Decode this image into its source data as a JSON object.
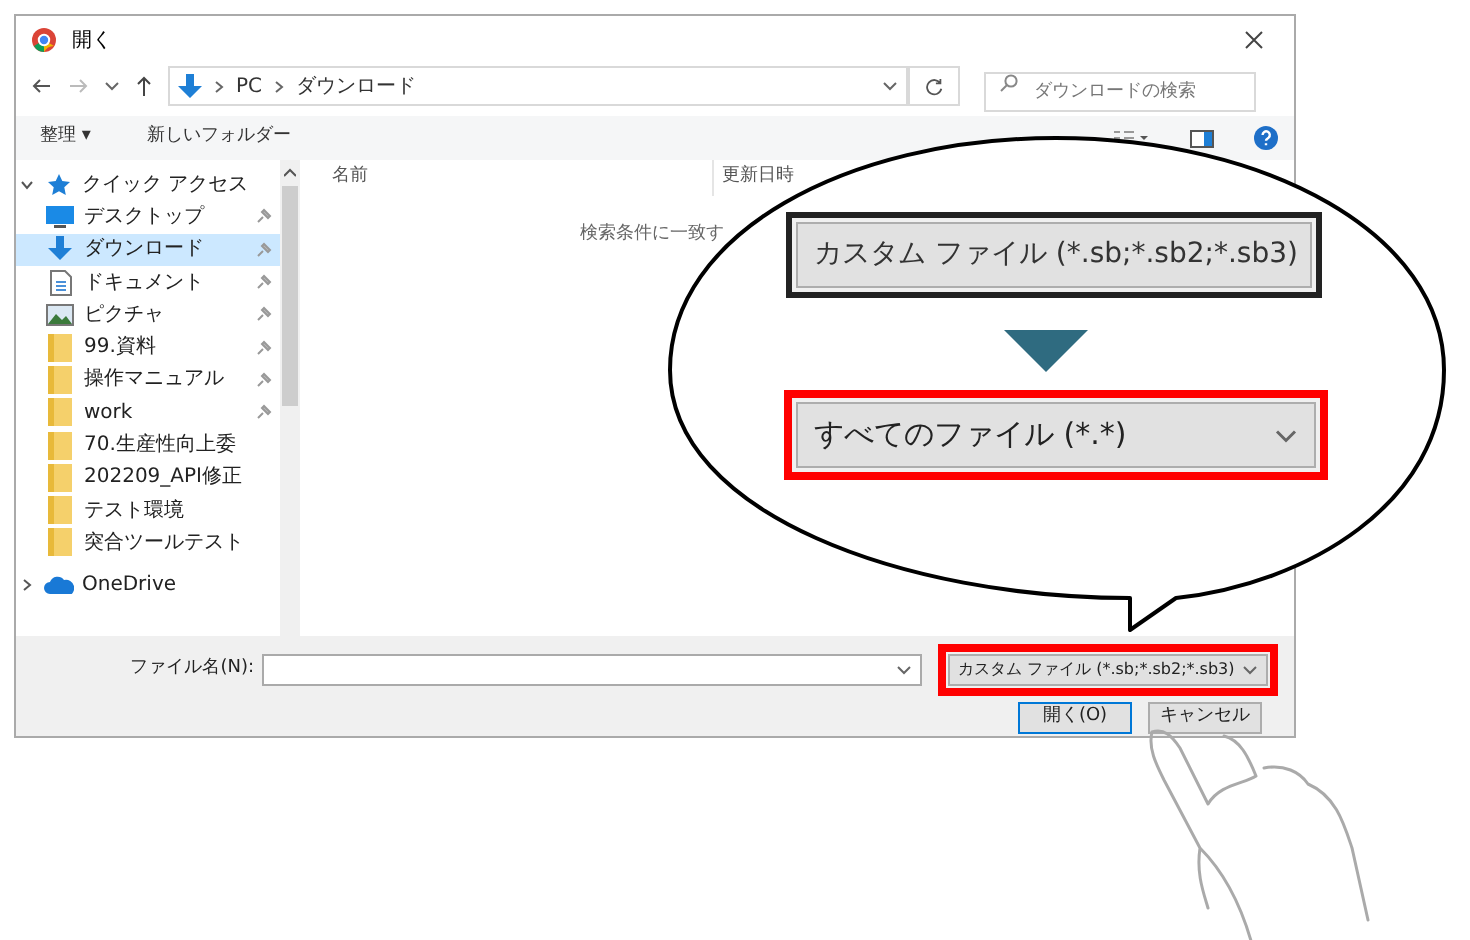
{
  "window": {
    "title": "開く"
  },
  "address": {
    "path": [
      "PC",
      "ダウンロード"
    ]
  },
  "search": {
    "placeholder": "ダウンロードの検索"
  },
  "toolbar": {
    "items": [
      "整理 ▾",
      "新しいフォルダー"
    ]
  },
  "sidebar": {
    "items": [
      {
        "label": "クイック アクセス",
        "kind": "quick",
        "expanded": true,
        "selected": false,
        "children": [
          {
            "label": "デスクトップ",
            "kind": "desktop",
            "pinned": true,
            "selected": false
          },
          {
            "label": "ダウンロード",
            "kind": "download",
            "pinned": true,
            "selected": true
          },
          {
            "label": "ドキュメント",
            "kind": "document",
            "pinned": true,
            "selected": false
          },
          {
            "label": "ピクチャ",
            "kind": "picture",
            "pinned": true,
            "selected": false
          },
          {
            "label": "99.資料",
            "kind": "folder",
            "pinned": true,
            "selected": false
          },
          {
            "label": "操作マニュアル",
            "kind": "folder",
            "pinned": true,
            "selected": false
          },
          {
            "label": "work",
            "kind": "folder",
            "pinned": true,
            "selected": false
          },
          {
            "label": "70.生産性向上委",
            "kind": "folder",
            "pinned": false,
            "selected": false
          },
          {
            "label": "202209_API修正",
            "kind": "folder",
            "pinned": false,
            "selected": false
          },
          {
            "label": "テスト環境",
            "kind": "folder",
            "pinned": false,
            "selected": false
          },
          {
            "label": "突合ツールテスト",
            "kind": "folder",
            "pinned": false,
            "selected": false
          }
        ]
      },
      {
        "label": "OneDrive",
        "kind": "cloud",
        "expanded": false,
        "selected": false
      }
    ]
  },
  "table": {
    "columns": [
      "名前",
      "更新日時"
    ],
    "empty_message": "検索条件に一致す"
  },
  "footer": {
    "filename_label": "ファイル名(N):",
    "filter": "カスタム ファイル (*.sb;*.sb2;*.sb3)",
    "buttons": [
      {
        "label": "開く(O)",
        "kind": "primary"
      },
      {
        "label": "キャンセル",
        "kind": "secondary"
      }
    ]
  },
  "callout": {
    "before": "カスタム ファイル (*.sb;*.sb2;*.sb3)",
    "after": "すべてのファイル (*.*)"
  }
}
